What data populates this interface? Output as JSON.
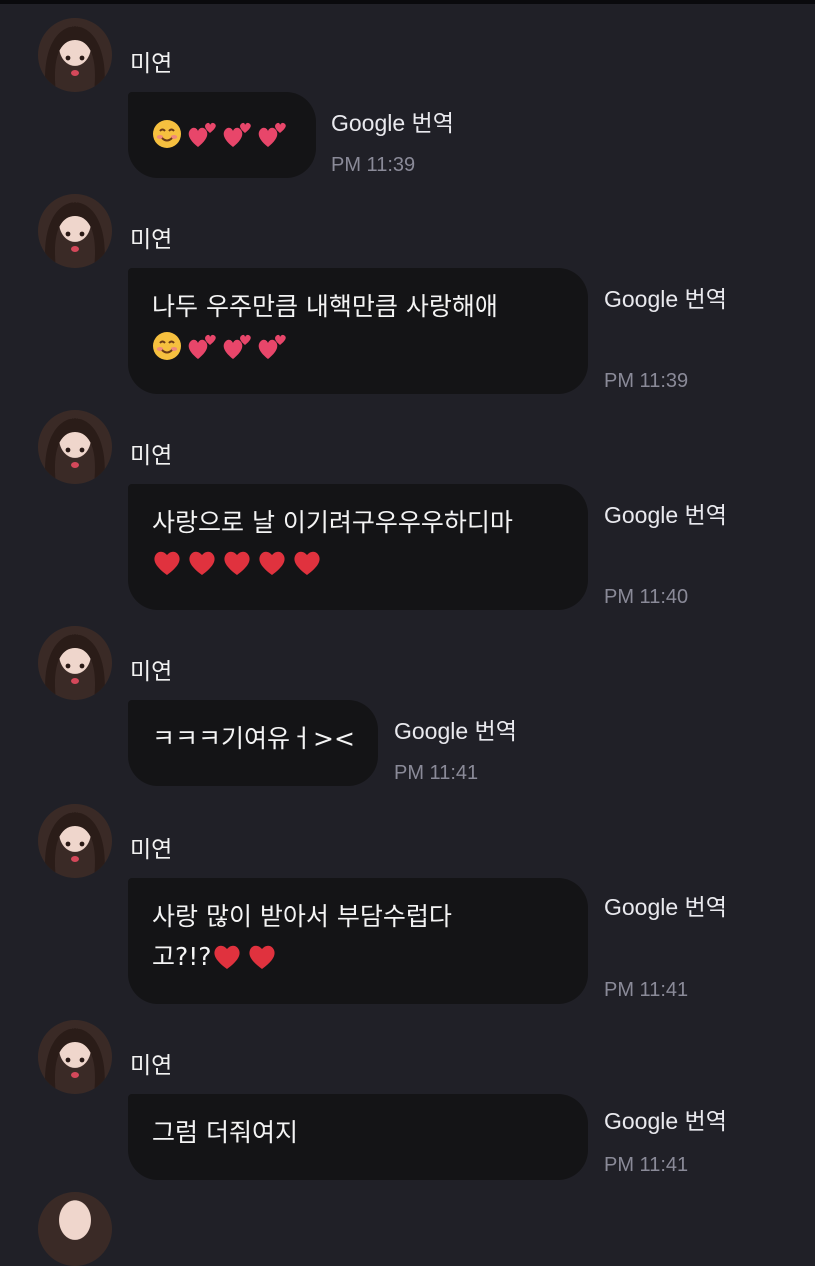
{
  "messages": [
    {
      "sender": "미연",
      "lines": [],
      "emoji": [
        "smile",
        "heart2",
        "heart2",
        "heart2"
      ],
      "translate": "Google 번역",
      "time": "PM 11:39"
    },
    {
      "sender": "미연",
      "lines": [
        "나두 우주만큼 내핵만큼 사랑해애"
      ],
      "emoji": [
        "smile",
        "heart2",
        "heart2",
        "heart2"
      ],
      "translate": "Google 번역",
      "time": "PM 11:39"
    },
    {
      "sender": "미연",
      "lines": [
        "사랑으로 날 이기려구우우우하디마"
      ],
      "emoji": [
        "heart",
        "heart",
        "heart",
        "heart",
        "heart"
      ],
      "translate": "Google 번역",
      "time": "PM 11:40"
    },
    {
      "sender": "미연",
      "lines": [
        "ㅋㅋㅋ기여유ㅓ><"
      ],
      "emoji": [],
      "translate": "Google 번역",
      "time": "PM 11:41"
    },
    {
      "sender": "미연",
      "lines": [
        "사랑 많이 받아서 부담수럽다",
        "고?!?"
      ],
      "emoji": [
        "heart",
        "heart"
      ],
      "translate": "Google 번역",
      "time": "PM 11:41"
    },
    {
      "sender": "미연",
      "lines": [
        "그럼 더줘여지"
      ],
      "emoji": [],
      "translate": "Google 번역",
      "time": "PM 11:41"
    }
  ],
  "colors": {
    "background": "#202027",
    "bubble": "#141416",
    "heart": "#e0323e",
    "heart2": "#e8466a"
  }
}
